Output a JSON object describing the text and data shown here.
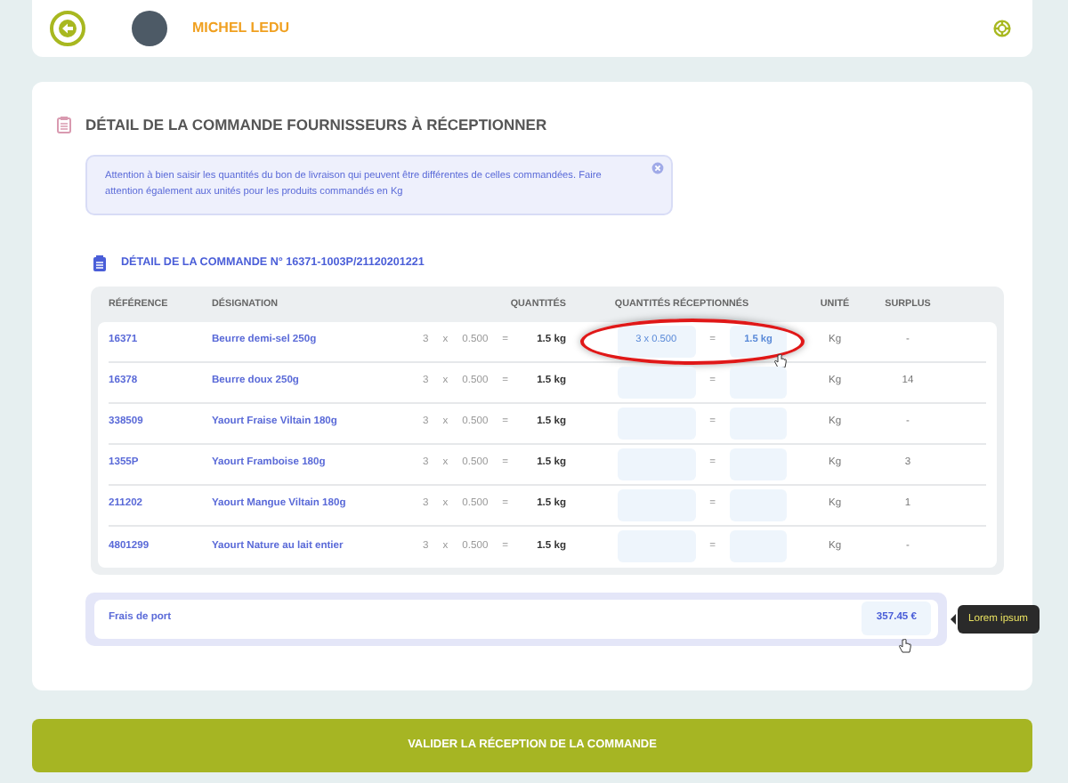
{
  "header": {
    "user_name": "MICHEL LEDU"
  },
  "title": "DÉTAIL DE LA COMMANDE FOURNISSEURS À RÉCEPTIONNER",
  "alert": {
    "text": "Attention à bien saisir les quantités du bon de livraison qui peuvent être différentes de celles commandées. Faire attention également aux unités pour les produits commandés en Kg"
  },
  "order_title": "DÉTAIL DE LA COMMANDE N° 16371-1003P/21120201221",
  "table": {
    "columns": [
      "RÉFÉRENCE",
      "DÉSIGNATION",
      "QUANTITÉS",
      "QUANTITÉS RÉCEPTIONNÉS",
      "UNITÉ",
      "SURPLUS"
    ],
    "rows": [
      {
        "reference": "16371",
        "designation": "Beurre demi-sel 250g",
        "quantity": [
          "3",
          "x",
          "0.500",
          "=",
          "1.5 kg"
        ],
        "received": {
          "value": "3 x 0.500",
          "sign": "=",
          "total": "1.5 kg"
        },
        "unit": "Kg",
        "surplus": "-",
        "highlighted": true
      },
      {
        "reference": "16378",
        "designation": "Beurre doux 250g",
        "quantity": [
          "3",
          "x",
          "0.500",
          "=",
          "1.5 kg"
        ],
        "received": {
          "sign": "="
        },
        "unit": "Kg",
        "surplus": "14",
        "highlighted": false
      },
      {
        "reference": "338509",
        "designation": "Yaourt Fraise Viltain 180g",
        "quantity": [
          "3",
          "x",
          "0.500",
          "=",
          "1.5 kg"
        ],
        "received": {
          "sign": "="
        },
        "unit": "Kg",
        "surplus": "-",
        "highlighted": false
      },
      {
        "reference": "1355P",
        "designation": "Yaourt Framboise 180g",
        "quantity": [
          "3",
          "x",
          "0.500",
          "=",
          "1.5 kg"
        ],
        "received": {
          "sign": "="
        },
        "unit": "Kg",
        "surplus": "3",
        "highlighted": false
      },
      {
        "reference": "211202",
        "designation": "Yaourt Mangue Viltain 180g",
        "quantity": [
          "3",
          "x",
          "0.500",
          "=",
          "1.5 kg"
        ],
        "received": {
          "sign": "="
        },
        "unit": "Kg",
        "surplus": "1",
        "highlighted": false
      },
      {
        "reference": "4801299",
        "designation": "Yaourt Nature au lait entier",
        "quantity": [
          "3",
          "x",
          "0.500",
          "=",
          "1.5 kg"
        ],
        "received": {
          "sign": "="
        },
        "unit": "Kg",
        "surplus": "-",
        "highlighted": false
      }
    ]
  },
  "shipping": {
    "label": "Frais de port",
    "amount": "357.45 €",
    "tooltip": "Lorem ipsum"
  },
  "submit_button": "VALIDER LA RÉCEPTION DE LA COMMANDE"
}
